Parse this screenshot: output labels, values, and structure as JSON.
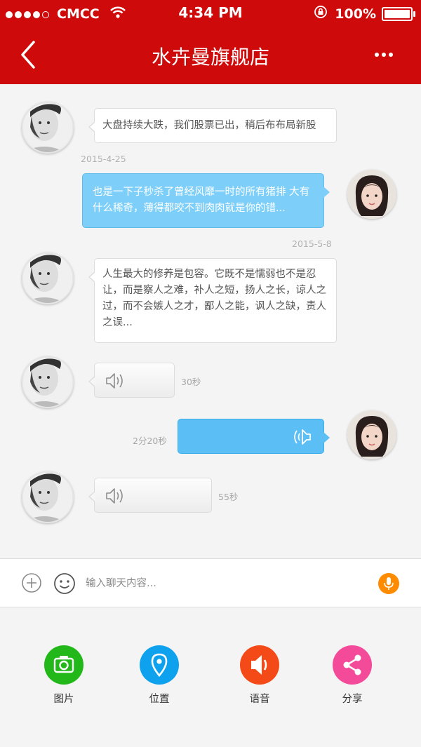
{
  "status_bar": {
    "carrier": "CMCC",
    "time": "4:34 PM",
    "battery": "100%"
  },
  "nav": {
    "title": "水卉曼旗舰店"
  },
  "messages": [
    {
      "text": "大盘持续大跌，我们股票已出，稍后布布局新股"
    },
    {
      "date": "2015-4-25"
    },
    {
      "text": "也是一下子秒杀了曾经风靡一时的所有猪排 大有什么稀奇，薄得都咬不到肉肉就是你的错..."
    },
    {
      "date": "2015-5-8"
    },
    {
      "text": "人生最大的修养是包容。它既不是懦弱也不是忍让，而是察人之难，补人之短，扬人之长，谅人之过，而不会嫉人之才，鄙人之能，讽人之缺，责人之误..."
    },
    {
      "duration": "30秒"
    },
    {
      "duration": "2分20秒"
    },
    {
      "duration": "55秒"
    }
  ],
  "input": {
    "placeholder": "输入聊天内容..."
  },
  "tools": [
    {
      "label": "图片",
      "icon": "camera-icon",
      "color": "#22b81a"
    },
    {
      "label": "位置",
      "icon": "location-pin-icon",
      "color": "#0ea2ee"
    },
    {
      "label": "语音",
      "icon": "speaker-icon",
      "color": "#f44a18"
    },
    {
      "label": "分享",
      "icon": "share-icon",
      "color": "#f34a9a"
    }
  ],
  "colors": {
    "header": "#cf0a0a",
    "bubble_sent": "#7dcffa",
    "mic": "#ff8b00"
  }
}
